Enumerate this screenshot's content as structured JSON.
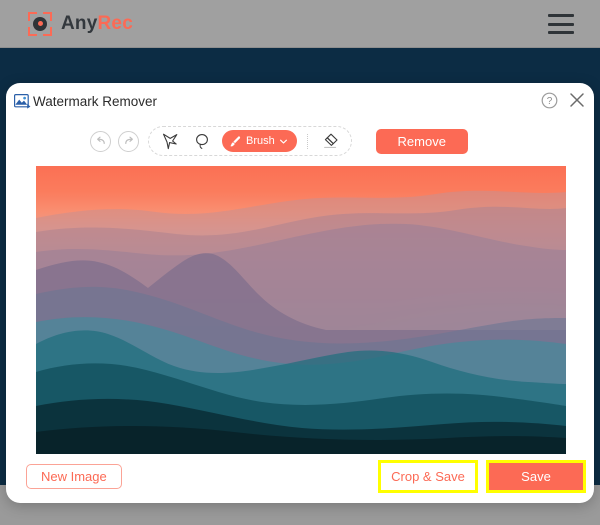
{
  "app": {
    "brand_primary": "Any",
    "brand_accent": "Rec",
    "accent_color": "#fc6a55",
    "navy_color": "#0c2c44",
    "topbar_color": "#a0a0a0",
    "menu_icon": "hamburger-menu-icon"
  },
  "dialog": {
    "title": "Watermark Remover",
    "title_icon": "image-picture-icon",
    "help_icon": "question-mark-circle-icon",
    "close_icon": "close-x-icon"
  },
  "toolbar": {
    "undo_icon": "undo-arrow-icon",
    "redo_icon": "redo-arrow-icon",
    "polygon_lasso_icon": "polygon-lasso-icon",
    "freehand_lasso_icon": "freehand-lasso-icon",
    "brush_label": "Brush",
    "brush_icon": "paintbrush-icon",
    "brush_chevron": "chevron-down-icon",
    "eraser_icon": "eraser-icon",
    "remove_label": "Remove"
  },
  "canvas": {
    "image_alt": "mountain-ridges-sunset-photo",
    "description": "Layered mountain ridges at sunset, orange sky fading to teal haze"
  },
  "footer": {
    "new_image_label": "New Image",
    "crop_save_label": "Crop & Save",
    "save_label": "Save",
    "highlight_color": "#ffff00"
  }
}
